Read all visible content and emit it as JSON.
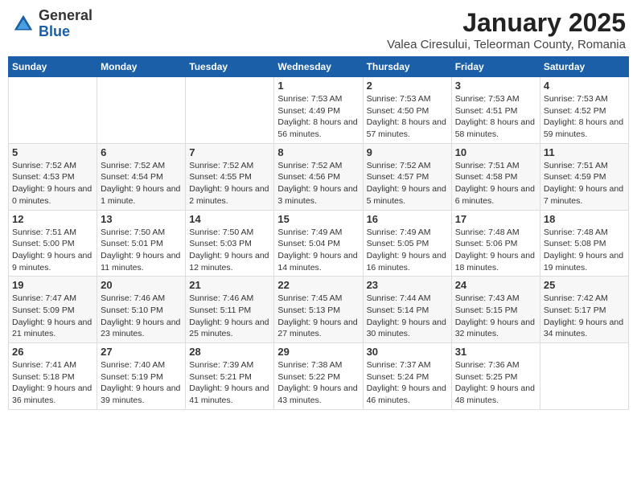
{
  "header": {
    "logo_general": "General",
    "logo_blue": "Blue",
    "month": "January 2025",
    "location": "Valea Ciresului, Teleorman County, Romania"
  },
  "weekdays": [
    "Sunday",
    "Monday",
    "Tuesday",
    "Wednesday",
    "Thursday",
    "Friday",
    "Saturday"
  ],
  "weeks": [
    [
      {
        "day": "",
        "content": ""
      },
      {
        "day": "",
        "content": ""
      },
      {
        "day": "",
        "content": ""
      },
      {
        "day": "1",
        "content": "Sunrise: 7:53 AM\nSunset: 4:49 PM\nDaylight: 8 hours and 56 minutes."
      },
      {
        "day": "2",
        "content": "Sunrise: 7:53 AM\nSunset: 4:50 PM\nDaylight: 8 hours and 57 minutes."
      },
      {
        "day": "3",
        "content": "Sunrise: 7:53 AM\nSunset: 4:51 PM\nDaylight: 8 hours and 58 minutes."
      },
      {
        "day": "4",
        "content": "Sunrise: 7:53 AM\nSunset: 4:52 PM\nDaylight: 8 hours and 59 minutes."
      }
    ],
    [
      {
        "day": "5",
        "content": "Sunrise: 7:52 AM\nSunset: 4:53 PM\nDaylight: 9 hours and 0 minutes."
      },
      {
        "day": "6",
        "content": "Sunrise: 7:52 AM\nSunset: 4:54 PM\nDaylight: 9 hours and 1 minute."
      },
      {
        "day": "7",
        "content": "Sunrise: 7:52 AM\nSunset: 4:55 PM\nDaylight: 9 hours and 2 minutes."
      },
      {
        "day": "8",
        "content": "Sunrise: 7:52 AM\nSunset: 4:56 PM\nDaylight: 9 hours and 3 minutes."
      },
      {
        "day": "9",
        "content": "Sunrise: 7:52 AM\nSunset: 4:57 PM\nDaylight: 9 hours and 5 minutes."
      },
      {
        "day": "10",
        "content": "Sunrise: 7:51 AM\nSunset: 4:58 PM\nDaylight: 9 hours and 6 minutes."
      },
      {
        "day": "11",
        "content": "Sunrise: 7:51 AM\nSunset: 4:59 PM\nDaylight: 9 hours and 7 minutes."
      }
    ],
    [
      {
        "day": "12",
        "content": "Sunrise: 7:51 AM\nSunset: 5:00 PM\nDaylight: 9 hours and 9 minutes."
      },
      {
        "day": "13",
        "content": "Sunrise: 7:50 AM\nSunset: 5:01 PM\nDaylight: 9 hours and 11 minutes."
      },
      {
        "day": "14",
        "content": "Sunrise: 7:50 AM\nSunset: 5:03 PM\nDaylight: 9 hours and 12 minutes."
      },
      {
        "day": "15",
        "content": "Sunrise: 7:49 AM\nSunset: 5:04 PM\nDaylight: 9 hours and 14 minutes."
      },
      {
        "day": "16",
        "content": "Sunrise: 7:49 AM\nSunset: 5:05 PM\nDaylight: 9 hours and 16 minutes."
      },
      {
        "day": "17",
        "content": "Sunrise: 7:48 AM\nSunset: 5:06 PM\nDaylight: 9 hours and 18 minutes."
      },
      {
        "day": "18",
        "content": "Sunrise: 7:48 AM\nSunset: 5:08 PM\nDaylight: 9 hours and 19 minutes."
      }
    ],
    [
      {
        "day": "19",
        "content": "Sunrise: 7:47 AM\nSunset: 5:09 PM\nDaylight: 9 hours and 21 minutes."
      },
      {
        "day": "20",
        "content": "Sunrise: 7:46 AM\nSunset: 5:10 PM\nDaylight: 9 hours and 23 minutes."
      },
      {
        "day": "21",
        "content": "Sunrise: 7:46 AM\nSunset: 5:11 PM\nDaylight: 9 hours and 25 minutes."
      },
      {
        "day": "22",
        "content": "Sunrise: 7:45 AM\nSunset: 5:13 PM\nDaylight: 9 hours and 27 minutes."
      },
      {
        "day": "23",
        "content": "Sunrise: 7:44 AM\nSunset: 5:14 PM\nDaylight: 9 hours and 30 minutes."
      },
      {
        "day": "24",
        "content": "Sunrise: 7:43 AM\nSunset: 5:15 PM\nDaylight: 9 hours and 32 minutes."
      },
      {
        "day": "25",
        "content": "Sunrise: 7:42 AM\nSunset: 5:17 PM\nDaylight: 9 hours and 34 minutes."
      }
    ],
    [
      {
        "day": "26",
        "content": "Sunrise: 7:41 AM\nSunset: 5:18 PM\nDaylight: 9 hours and 36 minutes."
      },
      {
        "day": "27",
        "content": "Sunrise: 7:40 AM\nSunset: 5:19 PM\nDaylight: 9 hours and 39 minutes."
      },
      {
        "day": "28",
        "content": "Sunrise: 7:39 AM\nSunset: 5:21 PM\nDaylight: 9 hours and 41 minutes."
      },
      {
        "day": "29",
        "content": "Sunrise: 7:38 AM\nSunset: 5:22 PM\nDaylight: 9 hours and 43 minutes."
      },
      {
        "day": "30",
        "content": "Sunrise: 7:37 AM\nSunset: 5:24 PM\nDaylight: 9 hours and 46 minutes."
      },
      {
        "day": "31",
        "content": "Sunrise: 7:36 AM\nSunset: 5:25 PM\nDaylight: 9 hours and 48 minutes."
      },
      {
        "day": "",
        "content": ""
      }
    ]
  ]
}
